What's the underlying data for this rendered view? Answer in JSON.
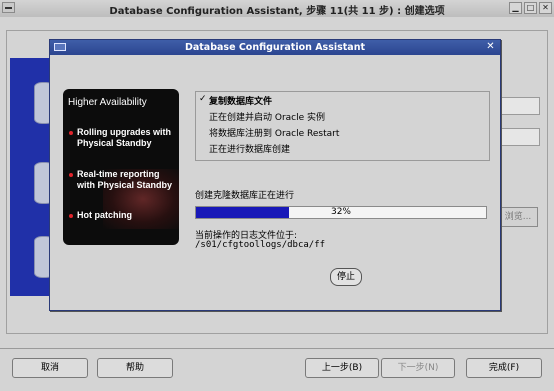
{
  "outer_window": {
    "title": "Database Configuration Assistant, 步骤 11(共 11 步) : 创建选项",
    "browse_label": "浏览..."
  },
  "footer": {
    "cancel": "取消",
    "help": "帮助",
    "back": "上一步(B)",
    "next": "下一步(N)",
    "finish": "完成(F)"
  },
  "dialog": {
    "title": "Database Configuration Assistant",
    "close_glyph": "✕",
    "promo": {
      "heading": "Higher Availability",
      "items": [
        "Rolling upgrades with Physical Standby",
        "Real-time reporting with Physical Standby",
        "Hot patching"
      ]
    },
    "steps": [
      {
        "label": "复制数据库文件",
        "done": true
      },
      {
        "label": "正在创建并启动 Oracle 实例",
        "done": false
      },
      {
        "label": "将数据库注册到 Oracle Restart",
        "done": false
      },
      {
        "label": "正在进行数据库创建",
        "done": false
      }
    ],
    "check_glyph": "✓",
    "progress_label": "创建克隆数据库正在进行",
    "progress_value": 32,
    "progress_text": "32%",
    "log_label": "当前操作的日志文件位于:",
    "log_path": "/s01/cfgtoollogs/dbca/ff",
    "stop_label": "停止"
  },
  "colors": {
    "dialog_title_bar": "#2b4590",
    "progress_fill": "#1818b8",
    "promo_background": "#0c0c0c",
    "promo_bullet": "#e0242c",
    "left_panel": "#2030a8"
  }
}
